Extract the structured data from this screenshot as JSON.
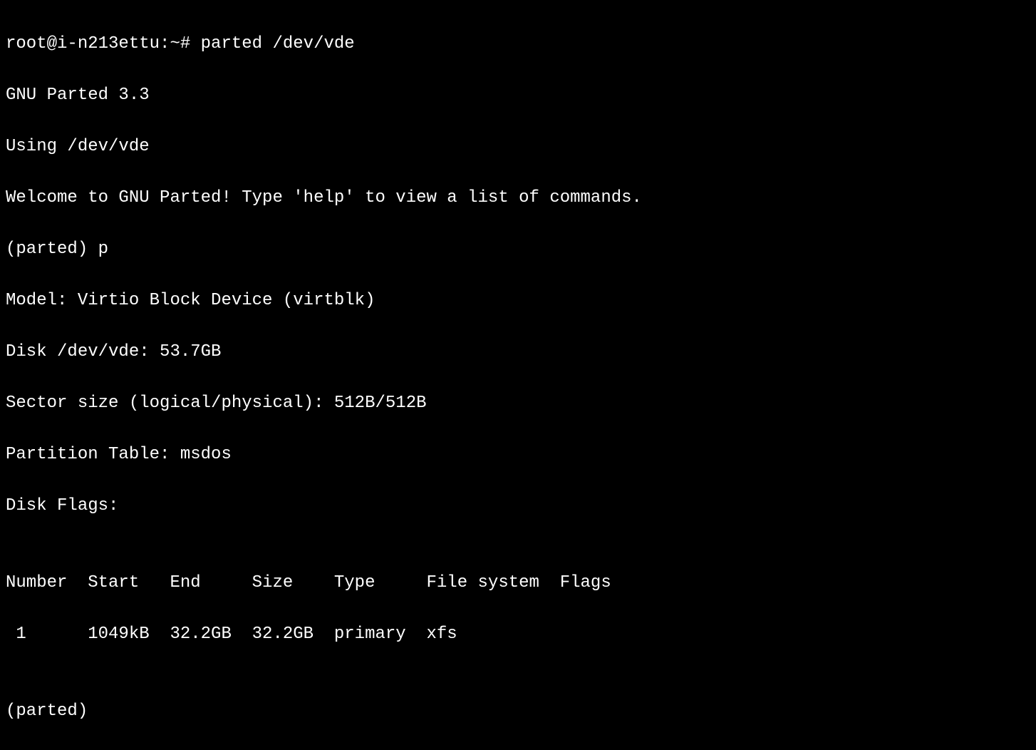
{
  "terminal": {
    "prompt_line": "root@i-n213ettu:~# parted /dev/vde",
    "program_version": "GNU Parted 3.3",
    "using_device": "Using /dev/vde",
    "welcome_msg": "Welcome to GNU Parted! Type 'help' to view a list of commands.",
    "parted_command": "(parted) p",
    "model_line": "Model: Virtio Block Device (virtblk)",
    "disk_line": "Disk /dev/vde: 53.7GB",
    "sector_line": "Sector size (logical/physical): 512B/512B",
    "partition_table": "Partition Table: msdos",
    "disk_flags": "Disk Flags:",
    "blank1": "",
    "table_header": "Number  Start   End     Size    Type     File system  Flags",
    "table_row1": " 1      1049kB  32.2GB  32.2GB  primary  xfs",
    "blank2": "",
    "parted_prompt": "(parted)"
  }
}
